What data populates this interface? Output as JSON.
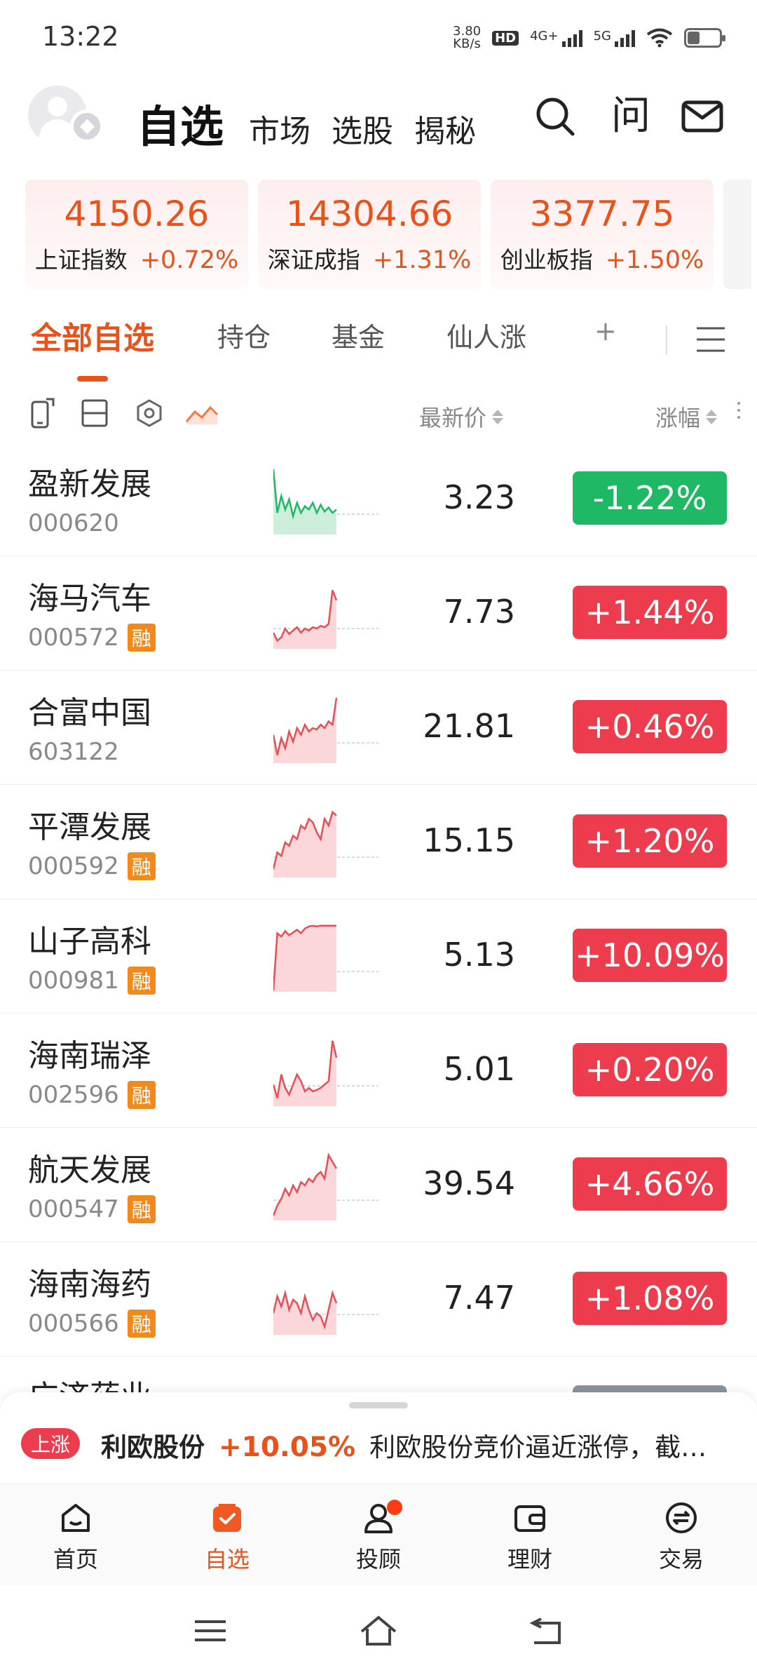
{
  "status_bar": {
    "time": "13:22",
    "net_speed_value": "3.80",
    "net_speed_unit": "KB/s",
    "hd_label": "HD",
    "net1_label": "4G+",
    "net2_label": "5G",
    "battery_level": 0.35
  },
  "header": {
    "tabs": [
      "自选",
      "市场",
      "选股",
      "揭秘"
    ],
    "active_tab": "自选",
    "icons": [
      "search-icon",
      "ask-icon",
      "mail-icon"
    ],
    "ask_glyph": "问"
  },
  "indices": [
    {
      "name": "上证指数",
      "value": "4150.26",
      "change": "+0.72%"
    },
    {
      "name": "深证成指",
      "value": "14304.66",
      "change": "+1.31%"
    },
    {
      "name": "创业板指",
      "value": "3377.75",
      "change": "+1.50%"
    }
  ],
  "watch_tabs": {
    "items": [
      "全部自选",
      "持仓",
      "基金",
      "仙人涨",
      "+"
    ],
    "active": "全部自选"
  },
  "columns": {
    "price": "最新价",
    "change": "涨幅"
  },
  "stocks": [
    {
      "name": "盈新发展",
      "code": "000620",
      "rong": false,
      "price": "3.23",
      "change": "-1.22%",
      "direction": "down",
      "spark": [
        0.95,
        0.3,
        0.55,
        0.35,
        0.5,
        0.25,
        0.45,
        0.3,
        0.4,
        0.35,
        0.45,
        0.3,
        0.42,
        0.32,
        0.38,
        0.3,
        0.35
      ]
    },
    {
      "name": "海马汽车",
      "code": "000572",
      "rong": true,
      "price": "7.73",
      "change": "+1.44%",
      "direction": "up",
      "spark": [
        0.22,
        0.1,
        0.15,
        0.28,
        0.2,
        0.25,
        0.3,
        0.22,
        0.28,
        0.25,
        0.3,
        0.28,
        0.32,
        0.3,
        0.35,
        0.85,
        0.7
      ]
    },
    {
      "name": "合富中国",
      "code": "603122",
      "rong": false,
      "price": "21.81",
      "change": "+0.46%",
      "direction": "up",
      "spark": [
        0.4,
        0.1,
        0.35,
        0.2,
        0.45,
        0.3,
        0.5,
        0.4,
        0.55,
        0.45,
        0.5,
        0.48,
        0.55,
        0.5,
        0.6,
        0.55,
        0.95
      ]
    },
    {
      "name": "平潭发展",
      "code": "000592",
      "rong": true,
      "price": "15.15",
      "change": "+1.20%",
      "direction": "up",
      "spark": [
        0.1,
        0.35,
        0.3,
        0.5,
        0.45,
        0.6,
        0.55,
        0.75,
        0.7,
        0.85,
        0.8,
        0.65,
        0.55,
        0.85,
        0.75,
        0.95,
        0.9
      ]
    },
    {
      "name": "山子高科",
      "code": "000981",
      "rong": true,
      "price": "5.13",
      "change": "+10.09%",
      "direction": "up",
      "spark": [
        0.0,
        0.85,
        0.8,
        0.88,
        0.82,
        0.86,
        0.9,
        0.85,
        0.92,
        0.95,
        0.96,
        0.95,
        0.96,
        0.96,
        0.96,
        0.96,
        0.96
      ]
    },
    {
      "name": "海南瑞泽",
      "code": "002596",
      "rong": true,
      "price": "5.01",
      "change": "+0.20%",
      "direction": "up",
      "spark": [
        0.3,
        0.1,
        0.45,
        0.25,
        0.15,
        0.3,
        0.45,
        0.35,
        0.2,
        0.25,
        0.2,
        0.22,
        0.25,
        0.3,
        0.35,
        0.95,
        0.7
      ]
    },
    {
      "name": "航天发展",
      "code": "000547",
      "rong": true,
      "price": "39.54",
      "change": "+4.66%",
      "direction": "up",
      "spark": [
        0.05,
        0.2,
        0.3,
        0.45,
        0.35,
        0.5,
        0.4,
        0.55,
        0.5,
        0.6,
        0.55,
        0.65,
        0.7,
        0.6,
        0.95,
        0.85,
        0.75
      ]
    },
    {
      "name": "海南海药",
      "code": "000566",
      "rong": true,
      "price": "7.47",
      "change": "+1.08%",
      "direction": "up",
      "spark": [
        0.3,
        0.55,
        0.4,
        0.6,
        0.35,
        0.5,
        0.45,
        0.3,
        0.55,
        0.35,
        0.2,
        0.3,
        0.25,
        0.1,
        0.35,
        0.6,
        0.45
      ]
    }
  ],
  "partial_stock": {
    "name": "广济药业"
  },
  "ticker": {
    "badge": "上涨",
    "stock": "利欧股份",
    "change": "+10.05%",
    "text": "利欧股份竞价逼近涨停，截至…"
  },
  "bottom_nav": {
    "items": [
      {
        "label": "首页",
        "icon": "home-icon"
      },
      {
        "label": "自选",
        "icon": "watchlist-icon"
      },
      {
        "label": "投顾",
        "icon": "advisor-icon"
      },
      {
        "label": "理财",
        "icon": "wallet-icon"
      },
      {
        "label": "交易",
        "icon": "trade-icon"
      }
    ],
    "active": "自选"
  },
  "colors": {
    "accent": "#e8531c",
    "up": "#ee3c4f",
    "down": "#1fb864",
    "spark_up_line": "#e94d55",
    "spark_down_line": "#1fb864"
  }
}
